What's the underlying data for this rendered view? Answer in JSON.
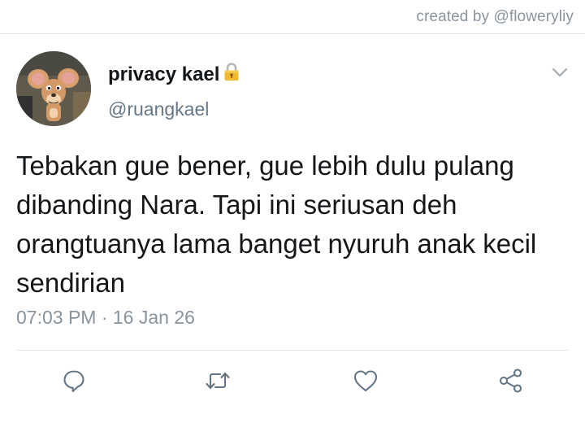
{
  "credit": "created by @floweryliy",
  "author": {
    "display_name": "privacy kael",
    "handle": "@ruangkael",
    "lock_icon": "lock-icon",
    "avatar_icon": "avatar-mouse-icon"
  },
  "tweet": {
    "text": "Tebakan gue bener, gue lebih dulu pulang dibanding Nara. Tapi ini seriusan deh orangtuanya lama banget nyuruh anak kecil sendirian",
    "timestamp": "07:03 PM · 16 Jan 26"
  },
  "actions": {
    "reply_icon": "reply-icon",
    "retweet_icon": "retweet-icon",
    "like_icon": "heart-icon",
    "share_icon": "share-icon",
    "menu_icon": "chevron-down-icon"
  },
  "colors": {
    "text": "#14171a",
    "secondary": "#657786",
    "icon": "#657786",
    "divider": "#e3e6e9"
  }
}
